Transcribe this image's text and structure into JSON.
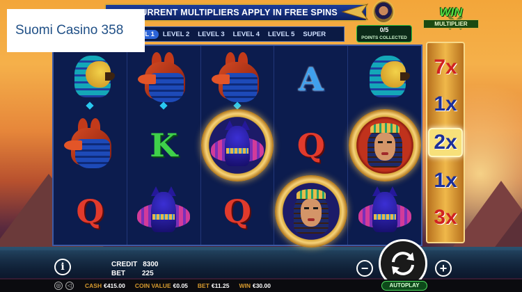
{
  "brand": {
    "watermark": "Suomi Casino 358"
  },
  "banner": {
    "text": "CURRENT MULTIPLIERS APPLY IN FREE SPINS"
  },
  "levels": {
    "items": [
      "LEVEL 1",
      "LEVEL 2",
      "LEVEL 3",
      "LEVEL 4",
      "LEVEL 5",
      "SUPER"
    ],
    "active_index": 0,
    "visible_active_label": "EL 1"
  },
  "points": {
    "value": "0/5",
    "label": "POINTS COLLECTED"
  },
  "win_logo": {
    "win": "WIN",
    "multiplier": "MULTIPLIER"
  },
  "multipliers": {
    "items": [
      "7x",
      "1x",
      "2x",
      "1x",
      "3x"
    ],
    "active_index": 2
  },
  "reels": [
    [
      "horus",
      "anubis",
      "anubis",
      "letter-A",
      "horus"
    ],
    [
      "anubis",
      "letter-K",
      "cat-coin",
      "letter-Q",
      "queen-coin"
    ],
    [
      "letter-Q",
      "cat",
      "letter-Q",
      "queen-coin",
      "cat"
    ]
  ],
  "letters": {
    "A": "A",
    "K": "K",
    "Q": "Q"
  },
  "credit": {
    "label": "CREDIT",
    "value": "8300"
  },
  "bet": {
    "label": "BET",
    "value": "225"
  },
  "buttons": {
    "autoplay": "AUTOPLAY",
    "minus": "−",
    "plus": "+",
    "info": "i"
  },
  "footer": {
    "cash_label": "CASH",
    "cash_value": "€415.00",
    "coin_label": "COIN VALUE",
    "coin_value": "€0.05",
    "bet_label": "BET",
    "bet_value": "€11.25",
    "win_label": "WIN",
    "win_value": "€30.00"
  },
  "colors": {
    "accent_gold": "#d8a93c",
    "win_green": "#58e043",
    "banner_blue": "#1d3d9c"
  }
}
